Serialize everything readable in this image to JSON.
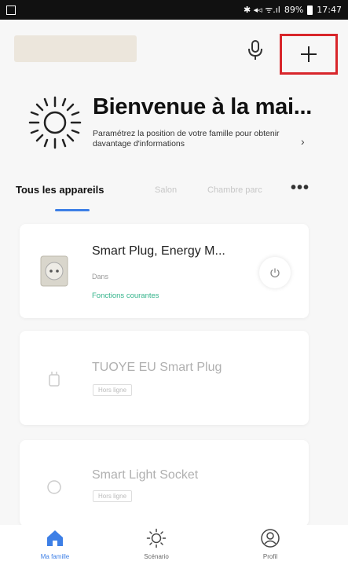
{
  "status_bar": {
    "signal_text": "✱ ◂◃ ᯤ.ıl",
    "battery_pct": "89%",
    "time": "17:47"
  },
  "header": {
    "home_name": "",
    "mic_icon": "microphone-icon",
    "add_icon": "plus-icon",
    "highlight_color": "#d8262b"
  },
  "welcome": {
    "title": "Bienvenue à la mai...",
    "subtitle": "Paramétrez la position de votre famille pour obtenir davantage d'informations",
    "arrow": "›"
  },
  "tabs": {
    "items": [
      {
        "label": "Tous les appareils"
      },
      {
        "label": "Salon"
      },
      {
        "label": "Chambre parc"
      }
    ],
    "more": "•••",
    "accent": "#3d7fe6"
  },
  "devices": [
    {
      "name": "Smart Plug, Energy M...",
      "status": "Dans",
      "function_label": "Fonctions courantes",
      "icon": "socket-icon"
    },
    {
      "name": "TUOYE EU Smart Plug",
      "badge": "Hors ligne",
      "icon": "plug-icon"
    },
    {
      "name": "Smart Light Socket",
      "badge": "Hors ligne",
      "icon": "bulb-socket-icon"
    }
  ],
  "bottom_nav": {
    "items": [
      {
        "label": "Ma famille",
        "icon": "home-icon"
      },
      {
        "label": "Scénario",
        "icon": "scene-sun-icon"
      },
      {
        "label": "Profil",
        "icon": "profile-icon"
      }
    ]
  }
}
